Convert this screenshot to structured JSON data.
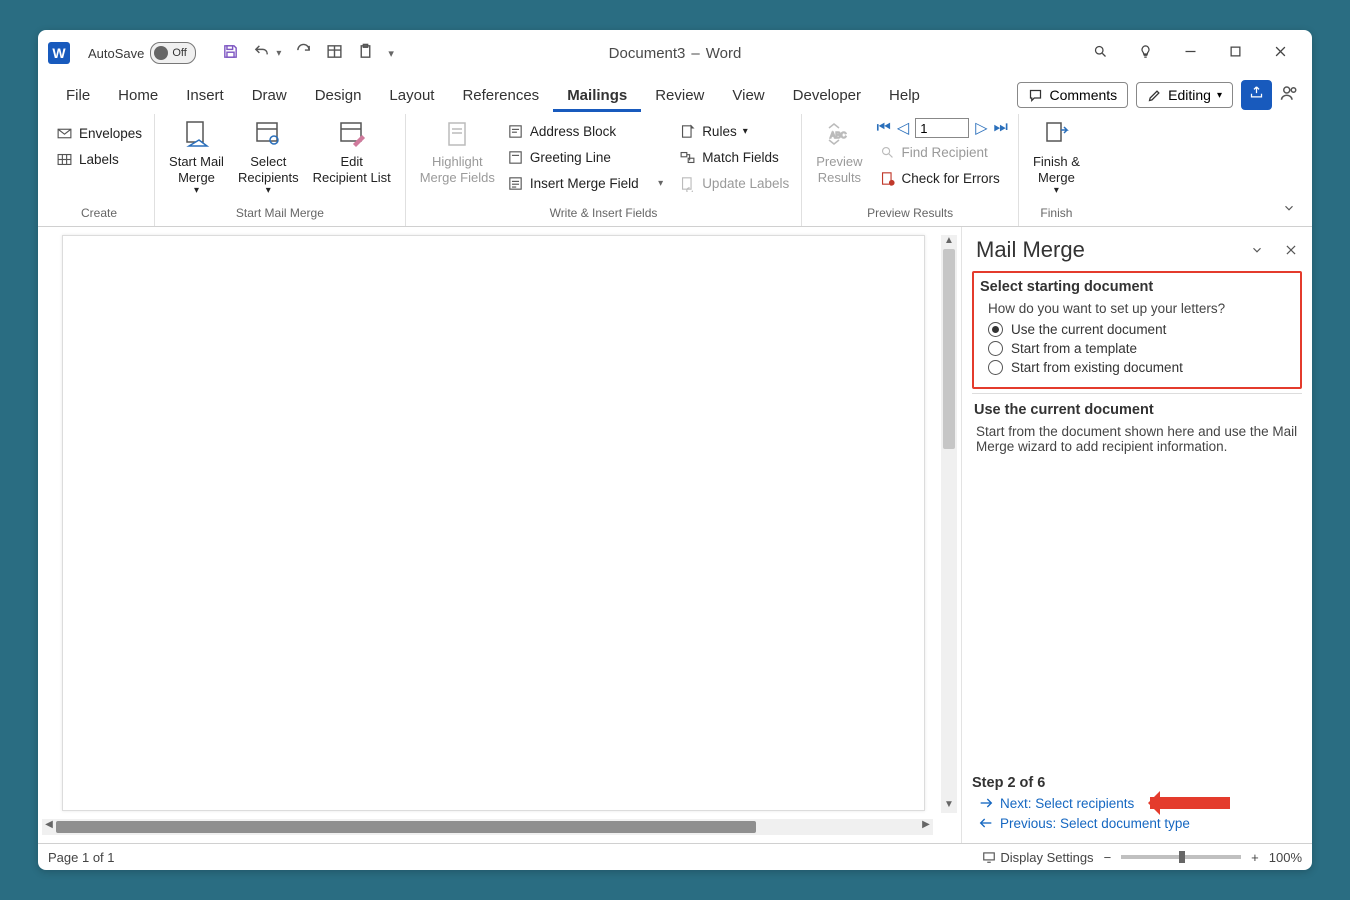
{
  "title": {
    "autosave_label": "AutoSave",
    "autosave_state": "Off",
    "doc_name": "Document3",
    "dash": "–",
    "app": "Word"
  },
  "tabs": {
    "items": [
      "File",
      "Home",
      "Insert",
      "Draw",
      "Design",
      "Layout",
      "References",
      "Mailings",
      "Review",
      "View",
      "Developer",
      "Help"
    ],
    "active": 7,
    "comments": "Comments",
    "editing": "Editing"
  },
  "ribbon": {
    "create": {
      "label": "Create",
      "envelopes": "Envelopes",
      "labels": "Labels"
    },
    "start": {
      "label": "Start Mail Merge",
      "start": "Start Mail\nMerge",
      "select": "Select\nRecipients",
      "edit": "Edit\nRecipient List"
    },
    "write": {
      "label": "Write & Insert Fields",
      "highlight": "Highlight\nMerge Fields",
      "address": "Address Block",
      "greeting": "Greeting Line",
      "insert_field": "Insert Merge Field",
      "rules": "Rules",
      "match": "Match Fields",
      "update": "Update Labels"
    },
    "preview": {
      "label": "Preview Results",
      "preview": "Preview\nResults",
      "record": "1",
      "find": "Find Recipient",
      "check": "Check for Errors"
    },
    "finish": {
      "label": "Finish",
      "finish": "Finish &\nMerge"
    }
  },
  "pane": {
    "title": "Mail Merge",
    "sec1": {
      "heading": "Select starting document",
      "question": "How do you want to set up your letters?",
      "opts": [
        "Use the current document",
        "Start from a template",
        "Start from existing document"
      ],
      "selected": 0
    },
    "sec2": {
      "heading": "Use the current document",
      "body": "Start from the document shown here and use the Mail Merge wizard to add recipient information."
    },
    "step": {
      "label": "Step 2 of 6",
      "next": "Next: Select recipients",
      "prev": "Previous: Select document type"
    }
  },
  "status": {
    "page": "Page 1 of 1",
    "display": "Display Settings",
    "zoom": "100%"
  }
}
